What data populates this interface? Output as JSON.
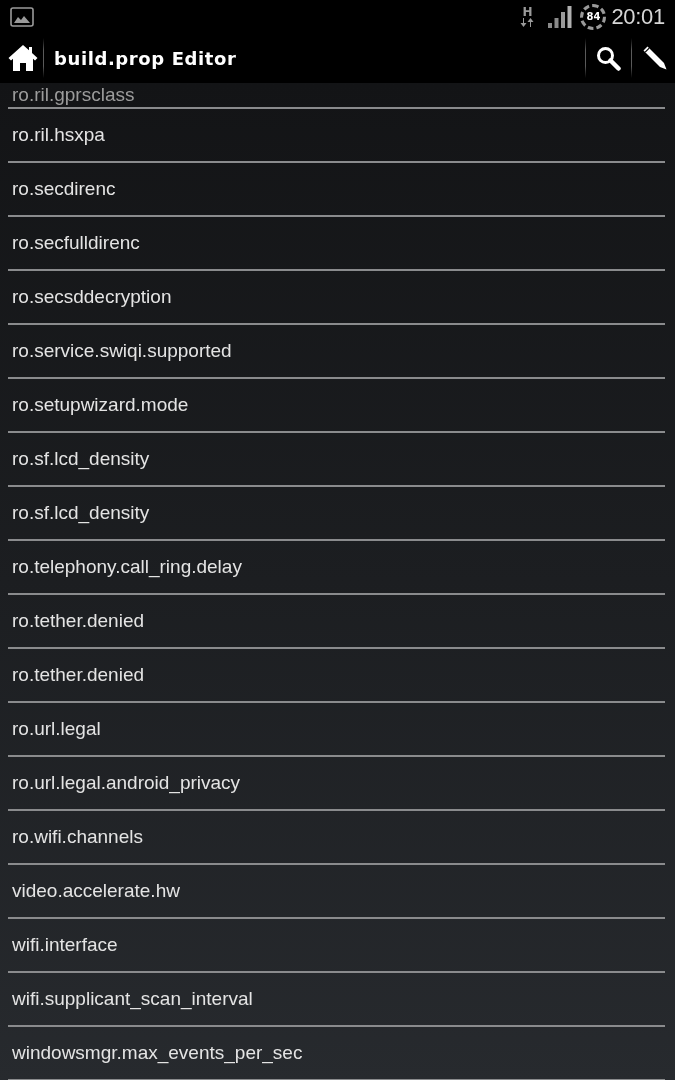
{
  "status_bar": {
    "network_type": "H",
    "battery": "84",
    "time": "20:01"
  },
  "action_bar": {
    "title": "build.prop Editor"
  },
  "properties": [
    "ro.ril.gprsclass",
    "ro.ril.hsxpa",
    "ro.secdirenc",
    "ro.secfulldirenc",
    "ro.secsddecryption",
    "ro.service.swiqi.supported",
    "ro.setupwizard.mode",
    "ro.sf.lcd_density",
    "ro.sf.lcd_density",
    "ro.telephony.call_ring.delay",
    "ro.tether.denied",
    "ro.tether.denied",
    "ro.url.legal",
    "ro.url.legal.android_privacy",
    "ro.wifi.channels",
    "video.accelerate.hw",
    "wifi.interface",
    "wifi.supplicant_scan_interval",
    "windowsmgr.max_events_per_sec"
  ]
}
